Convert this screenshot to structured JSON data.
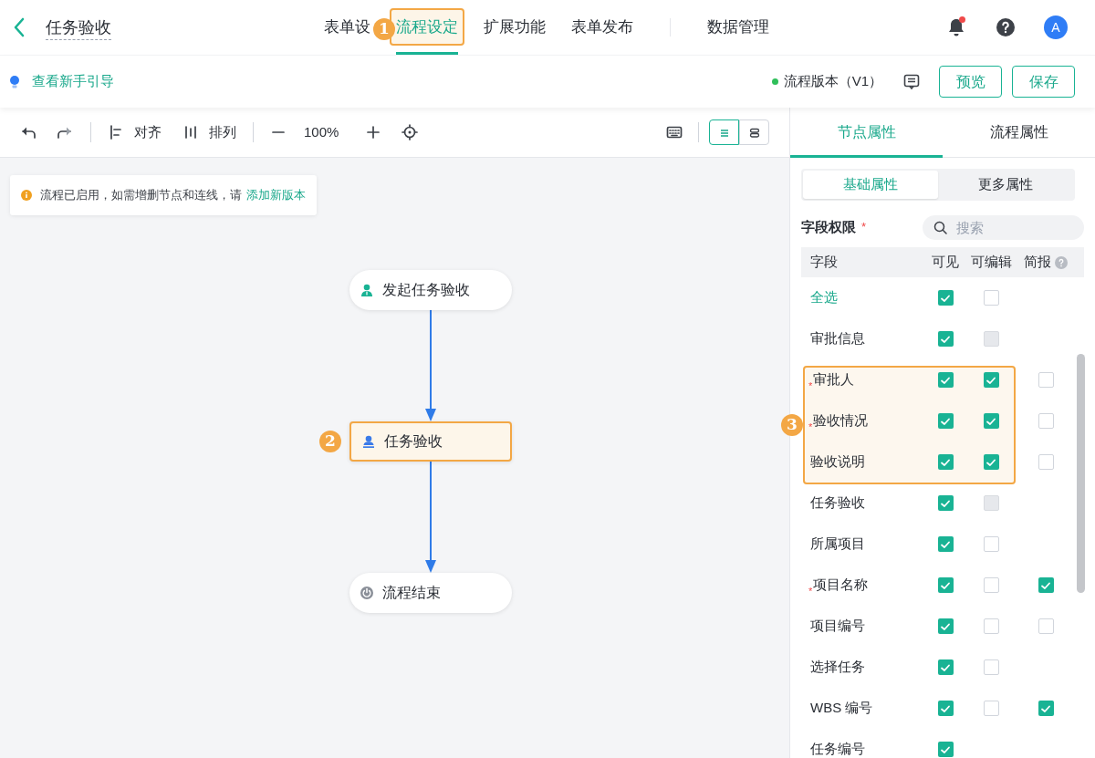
{
  "header": {
    "title": "任务验收",
    "notification": {
      "unread": true
    },
    "avatar": "A"
  },
  "nav_groups": [
    [
      {
        "label": "表单设",
        "selected": false
      },
      {
        "label": "流程设定",
        "selected": true,
        "callout": "1"
      },
      {
        "label": "扩展功能",
        "selected": false
      },
      {
        "label": "表单发布",
        "selected": false
      }
    ],
    [
      {
        "label": "数据管理",
        "selected": false
      }
    ]
  ],
  "subbar": {
    "guide_link": "查看新手引导",
    "version": {
      "label": "流程版本（V1）",
      "active": true
    },
    "buttons": [
      "预览",
      "保存"
    ]
  },
  "toolbar": {
    "align": "对齐",
    "arrange": "排列",
    "zoom": "100%",
    "view_modes": [
      {
        "selected": true
      },
      {
        "selected": false
      }
    ]
  },
  "notice": {
    "text": "流程已启用，如需增删节点和连线，请",
    "link": "添加新版本"
  },
  "nodes": [
    {
      "kind": "start",
      "label": "发起任务验收",
      "highlighted": false
    },
    {
      "kind": "approval",
      "label": "任务验收",
      "highlighted": true,
      "callout": "2"
    },
    {
      "kind": "end",
      "label": "流程结束",
      "highlighted": false
    }
  ],
  "panel": {
    "tabs": [
      {
        "label": "节点属性",
        "selected": true
      },
      {
        "label": "流程属性",
        "selected": false
      }
    ],
    "subtabs": [
      {
        "label": "基础属性",
        "selected": true
      },
      {
        "label": "更多属性",
        "selected": false
      }
    ],
    "section": {
      "title": "字段权限",
      "required_mark": "*"
    },
    "search": {
      "placeholder": "搜索"
    },
    "table": {
      "columns": [
        "字段",
        "可见",
        "可编辑",
        "简报"
      ],
      "callout": "3",
      "rows": [
        {
          "kind": "select_all",
          "label": "全选",
          "highlighted": false,
          "visible": {
            "checked": true,
            "disabled": false
          },
          "editable": {
            "checked": false,
            "disabled": false
          }
        },
        {
          "kind": "field",
          "label": "审批信息",
          "highlighted": false,
          "visible": {
            "checked": true,
            "disabled": false
          },
          "editable": {
            "checked": false,
            "disabled": true
          }
        },
        {
          "kind": "field",
          "marker": "*",
          "label": "审批人",
          "highlighted": true,
          "visible": {
            "checked": true,
            "disabled": false
          },
          "editable": {
            "checked": true,
            "disabled": false
          },
          "brief": {
            "checked": false,
            "disabled": false
          }
        },
        {
          "kind": "field",
          "marker": "*",
          "label": "验收情况",
          "highlighted": true,
          "visible": {
            "checked": true,
            "disabled": false
          },
          "editable": {
            "checked": true,
            "disabled": false
          },
          "brief": {
            "checked": false,
            "disabled": false
          }
        },
        {
          "kind": "field",
          "label": "验收说明",
          "highlighted": true,
          "visible": {
            "checked": true,
            "disabled": false
          },
          "editable": {
            "checked": true,
            "disabled": false
          },
          "brief": {
            "checked": false,
            "disabled": false
          }
        },
        {
          "kind": "field",
          "label": "任务验收",
          "highlighted": false,
          "visible": {
            "checked": true,
            "disabled": false
          },
          "editable": {
            "checked": false,
            "disabled": true
          }
        },
        {
          "kind": "field",
          "label": "所属项目",
          "highlighted": false,
          "visible": {
            "checked": true,
            "disabled": false
          },
          "editable": {
            "checked": false,
            "disabled": false
          }
        },
        {
          "kind": "field",
          "marker": "*",
          "label": "项目名称",
          "highlighted": false,
          "visible": {
            "checked": true,
            "disabled": false
          },
          "editable": {
            "checked": false,
            "disabled": false
          },
          "brief": {
            "checked": true,
            "disabled": false
          }
        },
        {
          "kind": "field",
          "label": "项目编号",
          "highlighted": false,
          "visible": {
            "checked": true,
            "disabled": false
          },
          "editable": {
            "checked": false,
            "disabled": false
          },
          "brief": {
            "checked": false,
            "disabled": false
          }
        },
        {
          "kind": "field",
          "label": "选择任务",
          "highlighted": false,
          "visible": {
            "checked": true,
            "disabled": false
          },
          "editable": {
            "checked": false,
            "disabled": false
          }
        },
        {
          "kind": "field",
          "label": "WBS 编号",
          "highlighted": false,
          "visible": {
            "checked": true,
            "disabled": false
          },
          "editable": {
            "checked": false,
            "disabled": false
          },
          "brief": {
            "checked": true,
            "disabled": false
          }
        },
        {
          "kind": "field",
          "label": "任务编号",
          "highlighted": false,
          "visible": {
            "checked": true,
            "disabled": false
          }
        }
      ]
    }
  }
}
